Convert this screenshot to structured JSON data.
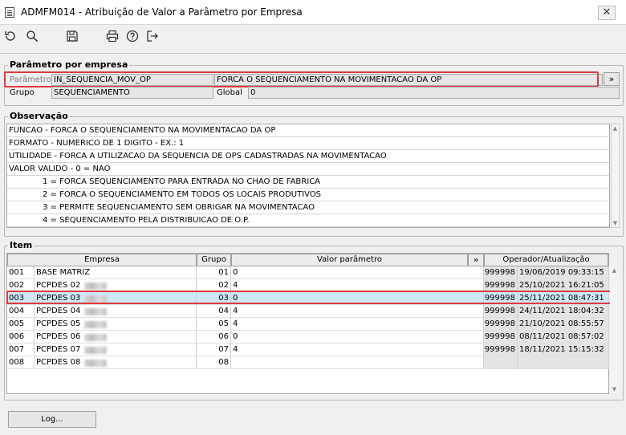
{
  "window": {
    "title": "ADMFM014 - Atribuição de Valor a Parâmetro por Empresa",
    "close_glyph": "✕"
  },
  "toolbar": {
    "icons": [
      "refresh-icon",
      "search-icon",
      "save-icon",
      "print-icon",
      "help-icon",
      "exit-icon"
    ]
  },
  "param_section": {
    "legend": "Parâmetro por empresa",
    "parametro_label": "Parâmetro",
    "parametro_value": "IN_SEQUENCIA_MOV_OP",
    "parametro_desc": "FORCA O SEQUENCIAMENTO NA MOVIMENTACAO DA OP",
    "expand_glyph": "»",
    "grupo_label": "Grupo",
    "grupo_value": "SEQUENCIAMENTO",
    "global_label": "Global",
    "global_value": "0"
  },
  "observacao": {
    "legend": "Observação",
    "lines": [
      "FUNCAO - FORCA O SEQUENCIAMENTO NA MOVIMENTACAO DA OP",
      "FORMATO - NUMERICO DE 1 DIGITO - EX.: 1",
      "UTILIDADE - FORCA A UTILIZACAO DA SEQUENCIA DE OPS CADASTRADAS NA MOVIMENTACAO",
      "VALOR VALIDO - 0 = NAO",
      "1 = FORCA SEQUENCIAMENTO PARA ENTRADA NO CHAO DE FABRICA",
      "2 = FORCA O SEQUENCIAMENTO EM TODOS OS LOCAIS PRODUTIVOS",
      "3 = PERMITE SEQUENCIAMENTO SEM OBRIGAR NA MOVIMENTACAO",
      "4 = SEQUENCIAMENTO PELA DISTRIBUICAO DE O.P."
    ]
  },
  "item": {
    "legend": "Item",
    "headers": {
      "empresa": "Empresa",
      "grupo": "Grupo",
      "valor": "Valor parâmetro",
      "expand": "»",
      "operador": "Operador/Atualização"
    },
    "rows": [
      {
        "cod": "001",
        "empresa": "BASE MATRIZ",
        "grupo": "01",
        "valor": "0",
        "operador": "999998",
        "data": "19/06/2019 09:33:15"
      },
      {
        "cod": "002",
        "empresa": "PCPDES 02",
        "grupo": "02",
        "valor": "4",
        "operador": "999998",
        "data": "25/10/2021 16:21:05"
      },
      {
        "cod": "003",
        "empresa": "PCPDES 03",
        "grupo": "03",
        "valor": "0",
        "operador": "999998",
        "data": "25/11/2021 08:47:31"
      },
      {
        "cod": "004",
        "empresa": "PCPDES 04",
        "grupo": "04",
        "valor": "4",
        "operador": "999998",
        "data": "24/11/2021 18:04:32"
      },
      {
        "cod": "005",
        "empresa": "PCPDES 05",
        "grupo": "05",
        "valor": "4",
        "operador": "999998",
        "data": "21/10/2021 08:55:57"
      },
      {
        "cod": "006",
        "empresa": "PCPDES 06",
        "grupo": "06",
        "valor": "0",
        "operador": "999998",
        "data": "08/11/2021 08:57:02"
      },
      {
        "cod": "007",
        "empresa": "PCPDES 07",
        "grupo": "07",
        "valor": "4",
        "operador": "999998",
        "data": "18/11/2021 15:15:32"
      },
      {
        "cod": "008",
        "empresa": "PCPDES 08",
        "grupo": "08",
        "valor": "",
        "operador": "",
        "data": ""
      }
    ]
  },
  "log_button": "Log..."
}
